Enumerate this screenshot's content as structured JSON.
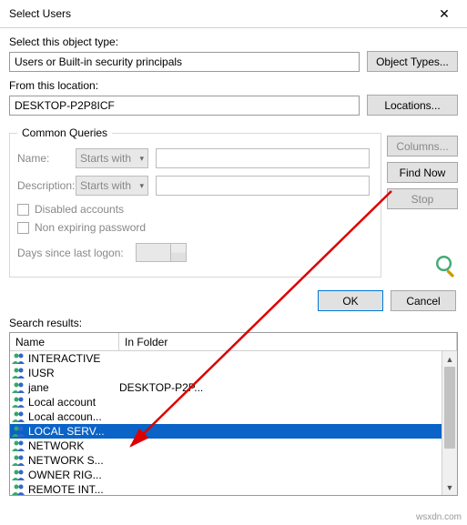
{
  "title": "Select Users",
  "labels": {
    "objectType": "Select this object type:",
    "fromLocation": "From this location:",
    "searchResults": "Search results:"
  },
  "inputs": {
    "objectType": "Users or Built-in security principals",
    "location": "DESKTOP-P2P8ICF"
  },
  "buttons": {
    "objectTypes": "Object Types...",
    "locations": "Locations...",
    "columns": "Columns...",
    "findNow": "Find Now",
    "stop": "Stop",
    "ok": "OK",
    "cancel": "Cancel"
  },
  "queries": {
    "legend": "Common Queries",
    "name": "Name:",
    "description": "Description:",
    "startsWith": "Starts with",
    "disabledAccounts": "Disabled accounts",
    "nonExpiring": "Non expiring password",
    "daysSince": "Days since last logon:"
  },
  "columns": {
    "name": "Name",
    "inFolder": "In Folder"
  },
  "rows": [
    {
      "name": "INTERACTIVE",
      "folder": "",
      "sel": false
    },
    {
      "name": "IUSR",
      "folder": "",
      "sel": false
    },
    {
      "name": "jane",
      "folder": "DESKTOP-P2P...",
      "sel": false
    },
    {
      "name": "Local account",
      "folder": "",
      "sel": false
    },
    {
      "name": "Local accoun...",
      "folder": "",
      "sel": false
    },
    {
      "name": "LOCAL SERV...",
      "folder": "",
      "sel": true
    },
    {
      "name": "NETWORK",
      "folder": "",
      "sel": false
    },
    {
      "name": "NETWORK S...",
      "folder": "",
      "sel": false
    },
    {
      "name": "OWNER RIG...",
      "folder": "",
      "sel": false
    },
    {
      "name": "REMOTE INT...",
      "folder": "",
      "sel": false
    }
  ],
  "watermark": "wsxdn.com"
}
